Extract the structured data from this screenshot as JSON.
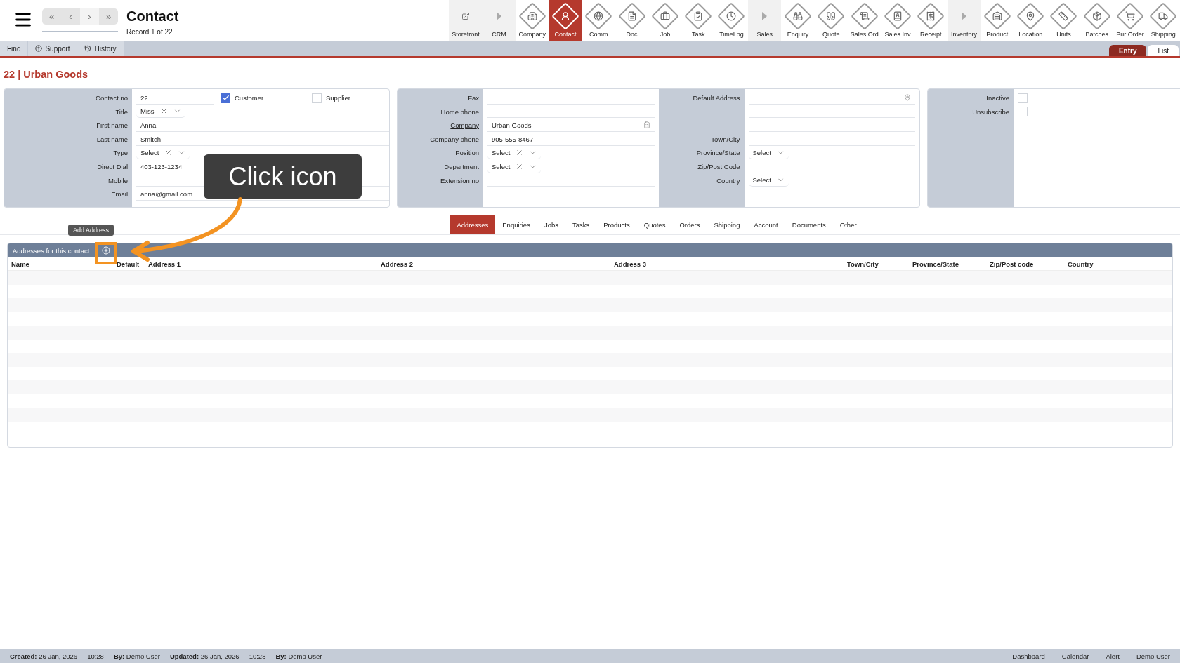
{
  "header": {
    "title": "Contact",
    "subtitle": "Record 1 of 22",
    "nav": [
      {
        "label": "«",
        "disabled": false
      },
      {
        "label": "‹",
        "disabled": false
      },
      {
        "label": "›",
        "disabled": true
      },
      {
        "label": "»",
        "disabled": false
      }
    ]
  },
  "modules": [
    {
      "label": "Storefront",
      "kind": "section",
      "selected": false
    },
    {
      "label": "CRM",
      "kind": "section",
      "selected": false
    },
    {
      "label": "Company",
      "kind": "module",
      "selected": false
    },
    {
      "label": "Contact",
      "kind": "module",
      "selected": true
    },
    {
      "label": "Comm",
      "kind": "module",
      "selected": false
    },
    {
      "label": "Doc",
      "kind": "module",
      "selected": false
    },
    {
      "label": "Job",
      "kind": "module",
      "selected": false
    },
    {
      "label": "Task",
      "kind": "module",
      "selected": false
    },
    {
      "label": "TimeLog",
      "kind": "module",
      "selected": false
    },
    {
      "label": "Sales",
      "kind": "section",
      "selected": false
    },
    {
      "label": "Enquiry",
      "kind": "module",
      "selected": false
    },
    {
      "label": "Quote",
      "kind": "module",
      "selected": false
    },
    {
      "label": "Sales Ord",
      "kind": "module",
      "selected": false
    },
    {
      "label": "Sales Inv",
      "kind": "module",
      "selected": false
    },
    {
      "label": "Receipt",
      "kind": "module",
      "selected": false
    },
    {
      "label": "Inventory",
      "kind": "section",
      "selected": false
    },
    {
      "label": "Product",
      "kind": "module",
      "selected": false
    },
    {
      "label": "Location",
      "kind": "module",
      "selected": false
    },
    {
      "label": "Units",
      "kind": "module",
      "selected": false
    },
    {
      "label": "Batches",
      "kind": "module",
      "selected": false
    },
    {
      "label": "Pur Order",
      "kind": "module",
      "selected": false
    },
    {
      "label": "Shipping",
      "kind": "module",
      "selected": false
    }
  ],
  "actions": [
    "Find",
    "Support",
    "History"
  ],
  "views": [
    {
      "label": "Entry",
      "selected": true
    },
    {
      "label": "List",
      "selected": false
    }
  ],
  "record_title": "22 | Urban Goods",
  "form": [
    {
      "columns": [
        {
          "rows": [
            {
              "label": "Contact no",
              "kind": "text",
              "value": "22",
              "checks": [
                {
                  "label": "Customer",
                  "checked": true
                },
                {
                  "label": "Supplier",
                  "checked": false
                }
              ]
            },
            {
              "label": "Title",
              "kind": "select",
              "value": "Miss",
              "clearable": true
            },
            {
              "label": "First name",
              "kind": "text",
              "value": "Anna"
            },
            {
              "label": "Last name",
              "kind": "text",
              "value": "Smitch"
            },
            {
              "label": "Type",
              "kind": "select",
              "value": "Select",
              "clearable": true
            },
            {
              "label": "Direct Dial",
              "kind": "text",
              "value": "403-123-1234"
            },
            {
              "label": "Mobile",
              "kind": "text"
            },
            {
              "label": "Email",
              "kind": "text",
              "value": "anna@gmail.com"
            }
          ]
        }
      ]
    },
    {
      "columns": [
        {
          "rows": [
            {
              "label": "Fax",
              "kind": "text"
            },
            {
              "label": "Home phone",
              "kind": "text"
            },
            {
              "label": "Company",
              "kind": "lookup",
              "value": "Urban Goods",
              "link": true
            },
            {
              "label": "Company phone",
              "kind": "text",
              "value": "905-555-8467"
            },
            {
              "label": "Position",
              "kind": "select",
              "value": "Select",
              "clearable": true
            },
            {
              "label": "Department",
              "kind": "select",
              "value": "Select",
              "clearable": true
            },
            {
              "label": "Extension no",
              "kind": "text"
            }
          ]
        },
        {
          "rows": [
            {
              "label": "Default Address",
              "kind": "address"
            },
            {
              "kind": "text"
            },
            {
              "kind": "text"
            },
            {
              "label": "Town/City",
              "kind": "text"
            },
            {
              "label": "Province/State",
              "kind": "select",
              "value": "Select",
              "clearable": false
            },
            {
              "label": "Zip/Post Code",
              "kind": "text"
            },
            {
              "label": "Country",
              "kind": "select",
              "value": "Select",
              "clearable": false
            }
          ]
        }
      ]
    },
    {
      "columns": [
        {
          "rows": [
            {
              "label": "Inactive",
              "kind": "checkbox",
              "checked": false
            },
            {
              "label": "Unsubscribe",
              "kind": "checkbox",
              "checked": false
            }
          ]
        }
      ]
    }
  ],
  "tabs": [
    {
      "label": "Addresses",
      "selected": true
    },
    {
      "label": "Enquiries",
      "selected": false
    },
    {
      "label": "Jobs",
      "selected": false
    },
    {
      "label": "Tasks",
      "selected": false
    },
    {
      "label": "Products",
      "selected": false
    },
    {
      "label": "Quotes",
      "selected": false
    },
    {
      "label": "Orders",
      "selected": false
    },
    {
      "label": "Shipping",
      "selected": false
    },
    {
      "label": "Account",
      "selected": false
    },
    {
      "label": "Documents",
      "selected": false
    },
    {
      "label": "Other",
      "selected": false
    }
  ],
  "table": {
    "title": "Addresses for this contact",
    "tooltip": "Add Address",
    "columns": [
      "Name",
      "Default",
      "Address 1",
      "Address 2",
      "Address 3",
      "Town/City",
      "Province/State",
      "Zip/Post code",
      "Country"
    ]
  },
  "callout": "Click icon",
  "status_bar": {
    "left": [
      {
        "label": "Created:",
        "value": "26 Jan, 2026"
      },
      {
        "value": "10:28"
      },
      {
        "label": "By:",
        "value": "Demo User"
      },
      {
        "label": "Updated:",
        "value": "26 Jan, 2026"
      },
      {
        "value": "10:28"
      },
      {
        "label": "By:",
        "value": "Demo User"
      }
    ],
    "right": [
      "Dashboard",
      "Calendar",
      "Alert",
      "Demo User"
    ]
  }
}
